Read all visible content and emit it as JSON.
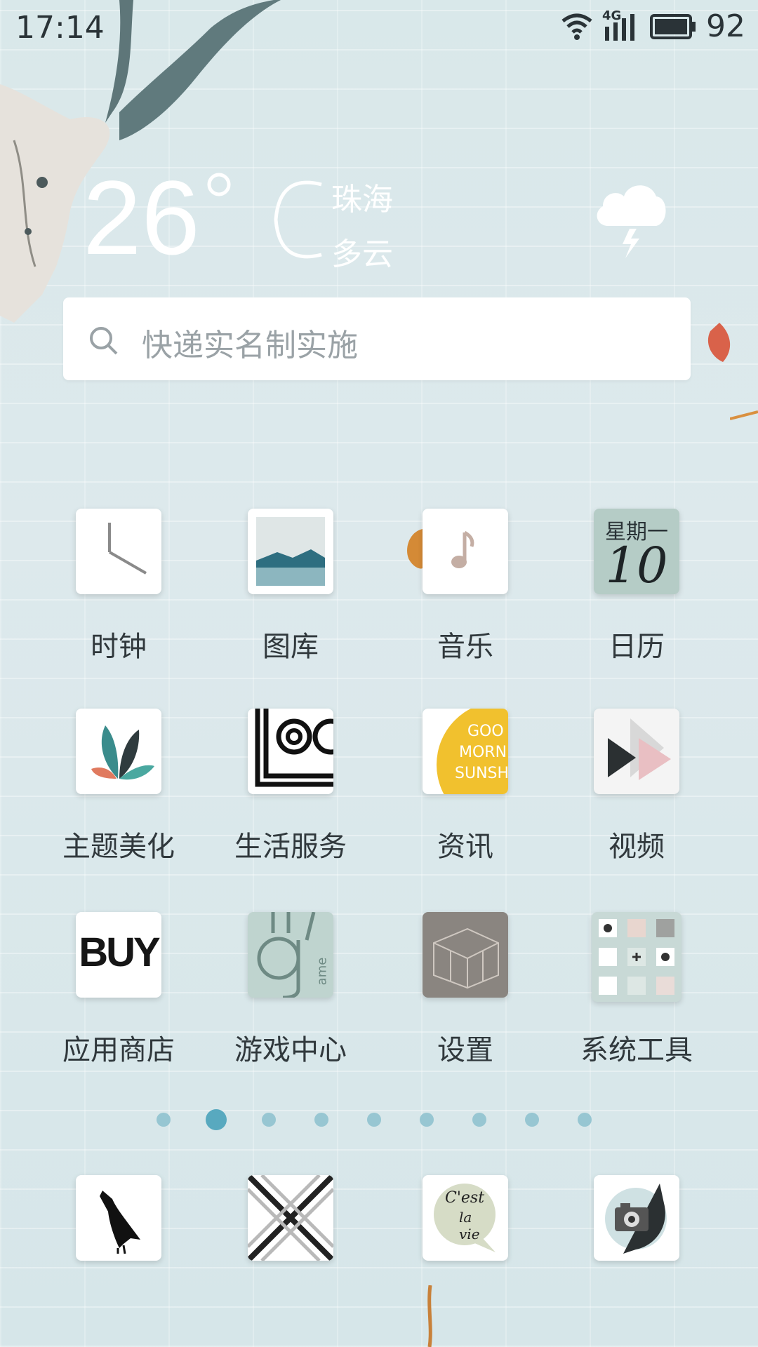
{
  "status_bar": {
    "time": "17:14",
    "network": "4G",
    "battery": "92"
  },
  "weather": {
    "temperature": "26",
    "unit": "°C",
    "city": "珠海",
    "condition": "多云"
  },
  "search": {
    "placeholder": "快递实名制实施"
  },
  "apps": [
    {
      "label": "时钟",
      "icon": "clock-icon"
    },
    {
      "label": "图库",
      "icon": "gallery-icon"
    },
    {
      "label": "音乐",
      "icon": "music-icon"
    },
    {
      "label": "日历",
      "icon": "calendar-icon",
      "calendar_weekday": "星期一",
      "calendar_day": "10"
    },
    {
      "label": "主题美化",
      "icon": "feather-icon"
    },
    {
      "label": "生活服务",
      "icon": "circles-icon"
    },
    {
      "label": "资讯",
      "icon": "news-icon",
      "tile_text": [
        "GOO",
        "MORNI",
        "SUNSH"
      ]
    },
    {
      "label": "视频",
      "icon": "video-icon"
    },
    {
      "label": "应用商店",
      "icon": "store-icon",
      "tile_text": "BUY"
    },
    {
      "label": "游戏中心",
      "icon": "game-icon",
      "tile_text": "ame"
    },
    {
      "label": "设置",
      "icon": "settings-icon"
    },
    {
      "label": "系统工具",
      "icon": "tools-folder-icon"
    }
  ],
  "page_indicator": {
    "count": 9,
    "active_index": 1
  },
  "dock": [
    {
      "icon": "bird-icon"
    },
    {
      "icon": "pattern-icon"
    },
    {
      "icon": "speech-bubble-icon",
      "tile_text": [
        "C'est",
        "la",
        "vie"
      ]
    },
    {
      "icon": "camera-icon"
    }
  ],
  "colors": {
    "accent_dot": "#58a9bf",
    "dot": "#97c6d2",
    "label": "#30383c"
  }
}
